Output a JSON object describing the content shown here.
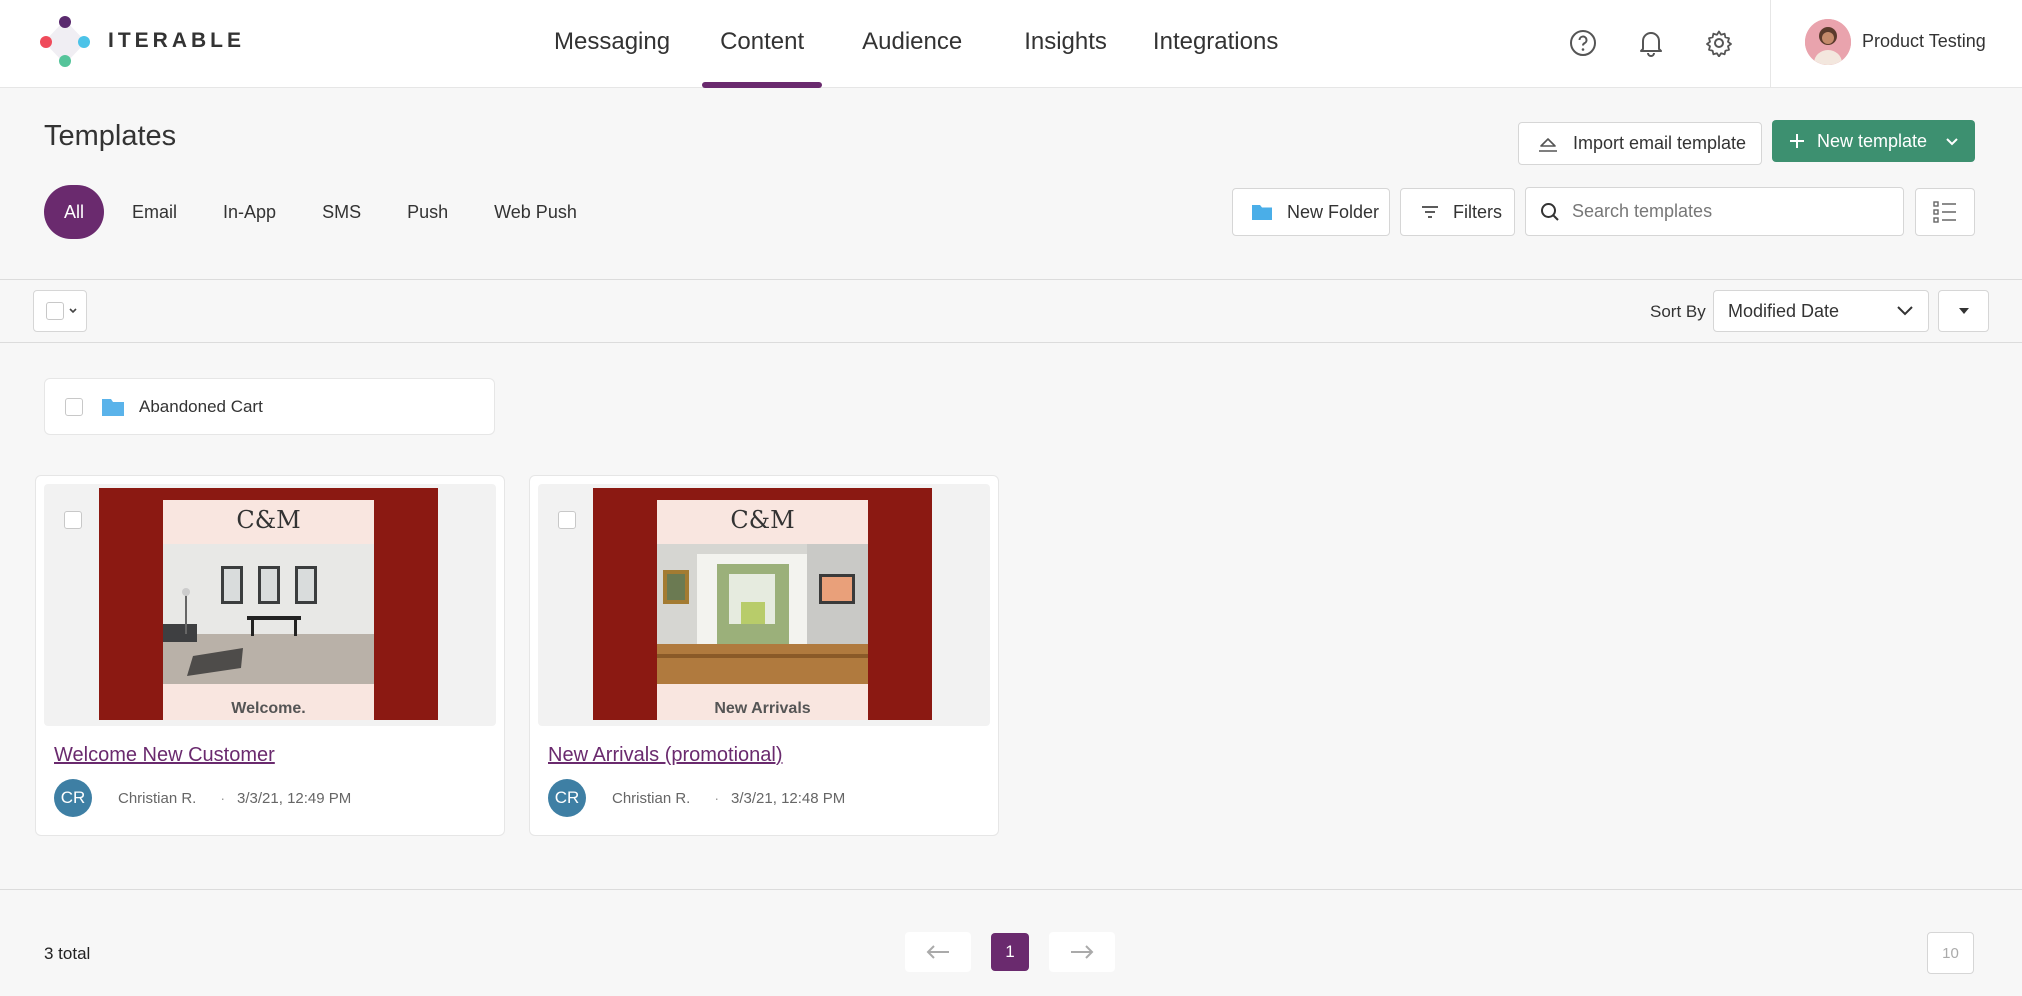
{
  "app": {
    "logo_text": "ITERABLE"
  },
  "nav": {
    "items": [
      "Messaging",
      "Content",
      "Audience",
      "Insights",
      "Integrations"
    ],
    "active": "Content"
  },
  "user": {
    "name": "Product Testing"
  },
  "page": {
    "title": "Templates"
  },
  "actions": {
    "import_label": "Import email template",
    "new_template_label": "New template",
    "new_folder_label": "New Folder",
    "filters_label": "Filters"
  },
  "tabs": [
    "All",
    "Email",
    "In-App",
    "SMS",
    "Push",
    "Web Push"
  ],
  "search": {
    "placeholder": "Search templates"
  },
  "sort": {
    "label": "Sort By",
    "value": "Modified Date"
  },
  "folders": [
    {
      "name": "Abandoned Cart"
    }
  ],
  "templates": [
    {
      "name": "Welcome New Customer",
      "preview_logo": "C&M",
      "preview_caption": "Welcome.",
      "author_initials": "CR",
      "author": "Christian R.",
      "modified": "3/3/21, 12:49 PM"
    },
    {
      "name": "New Arrivals (promotional)",
      "preview_logo": "C&M",
      "preview_caption": "New Arrivals",
      "author_initials": "CR",
      "author": "Christian R.",
      "modified": "3/3/21, 12:48 PM"
    }
  ],
  "pagination": {
    "total_label": "3 total",
    "current_page": "1",
    "page_size": "10"
  },
  "colors": {
    "brand": "#6a2a6e",
    "primary_button": "#3d9070",
    "email_red": "#8b1912",
    "avatar": "#3e7fa4"
  }
}
